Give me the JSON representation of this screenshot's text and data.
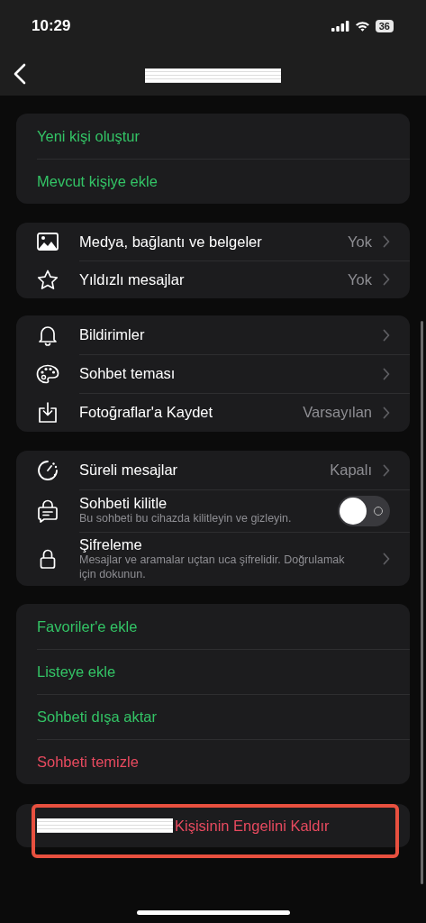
{
  "status_bar": {
    "time": "10:29",
    "battery": "36"
  },
  "nav": {
    "title_redacted": true
  },
  "groups": [
    {
      "rows": [
        {
          "kind": "link",
          "label": "Yeni kişi oluştur",
          "danger": false
        },
        {
          "kind": "link",
          "label": "Mevcut kişiye ekle",
          "danger": false
        }
      ]
    },
    {
      "rows": [
        {
          "kind": "nav",
          "label": "Medya, bağlantı ve belgeler",
          "value": "Yok"
        },
        {
          "kind": "nav",
          "label": "Yıldızlı mesajlar",
          "value": "Yok"
        }
      ]
    },
    {
      "rows": [
        {
          "kind": "nav",
          "label": "Bildirimler"
        },
        {
          "kind": "nav",
          "label": "Sohbet teması"
        },
        {
          "kind": "nav",
          "label": "Fotoğraflar'a Kaydet",
          "value": "Varsayılan"
        }
      ]
    },
    {
      "rows": [
        {
          "kind": "nav",
          "label": "Süreli mesajlar",
          "value": "Kapalı"
        },
        {
          "kind": "toggle",
          "label": "Sohbeti kilitle",
          "subtitle": "Bu sohbeti bu cihazda kilitleyin ve gizleyin.",
          "on": false
        },
        {
          "kind": "nav",
          "label": "Şifreleme",
          "subtitle": "Mesajlar ve aramalar uçtan uca şifrelidir. Doğrulamak için dokunun."
        }
      ]
    },
    {
      "rows": [
        {
          "kind": "link",
          "label": "Favoriler'e ekle",
          "danger": false
        },
        {
          "kind": "link",
          "label": "Listeye ekle",
          "danger": false
        },
        {
          "kind": "link",
          "label": "Sohbeti dışa aktar",
          "danger": false
        },
        {
          "kind": "link",
          "label": "Sohbeti temizle",
          "danger": true
        }
      ]
    },
    {
      "highlighted": true,
      "rows": [
        {
          "kind": "link",
          "label": "Kişisinin Engelini Kaldır",
          "danger": true,
          "redacted_prefix": true
        }
      ]
    }
  ]
}
